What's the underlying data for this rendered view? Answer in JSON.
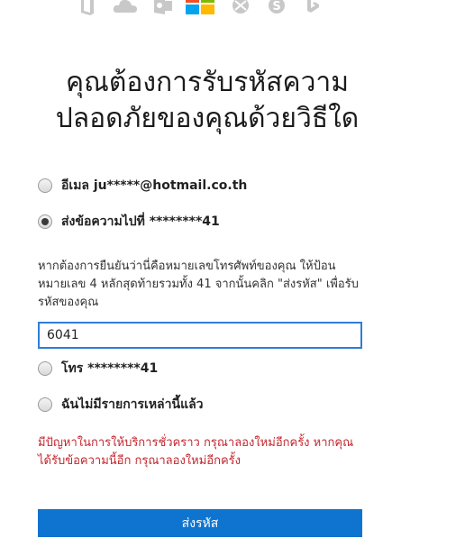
{
  "header": {
    "icons": [
      "office-icon",
      "onedrive-icon",
      "outlook-icon",
      "microsoft-logo",
      "xbox-icon",
      "skype-icon",
      "bing-icon"
    ]
  },
  "page": {
    "title_line1": "คุณต้องการรับรหัสความ",
    "title_line2": "ปลอดภัยของคุณด้วยวิธีใด"
  },
  "options": [
    {
      "label": "อีเมล ju*****@hotmail.co.th",
      "checked": false
    },
    {
      "label": "ส่งข้อความไปที่ ********41",
      "checked": true
    },
    {
      "label": "โทร ********41",
      "checked": false
    },
    {
      "label": "ฉันไม่มีรายการเหล่านี้แล้ว",
      "checked": false
    }
  ],
  "verify": {
    "description": "หากต้องการยืนยันว่านี่คือหมายเลขโทรศัพท์ของคุณ ให้ป้อนหมายเลข 4 หลักสุดท้ายรวมทั้ง 41 จากนั้นคลิก \"ส่งรหัส\" เพื่อรับรหัสของคุณ",
    "input_value": "6041"
  },
  "error": {
    "message": "มีปัญหาในการให้บริการชั่วคราว กรุณาลองใหม่อีกครั้ง หากคุณได้รับข้อความนี้อีก กรุณาลองใหม่อีกครั้ง"
  },
  "actions": {
    "submit_label": "ส่งรหัส"
  },
  "colors": {
    "accent": "#0f74d0",
    "error": "#c4262e",
    "icon_gray": "#c8c8c8"
  }
}
